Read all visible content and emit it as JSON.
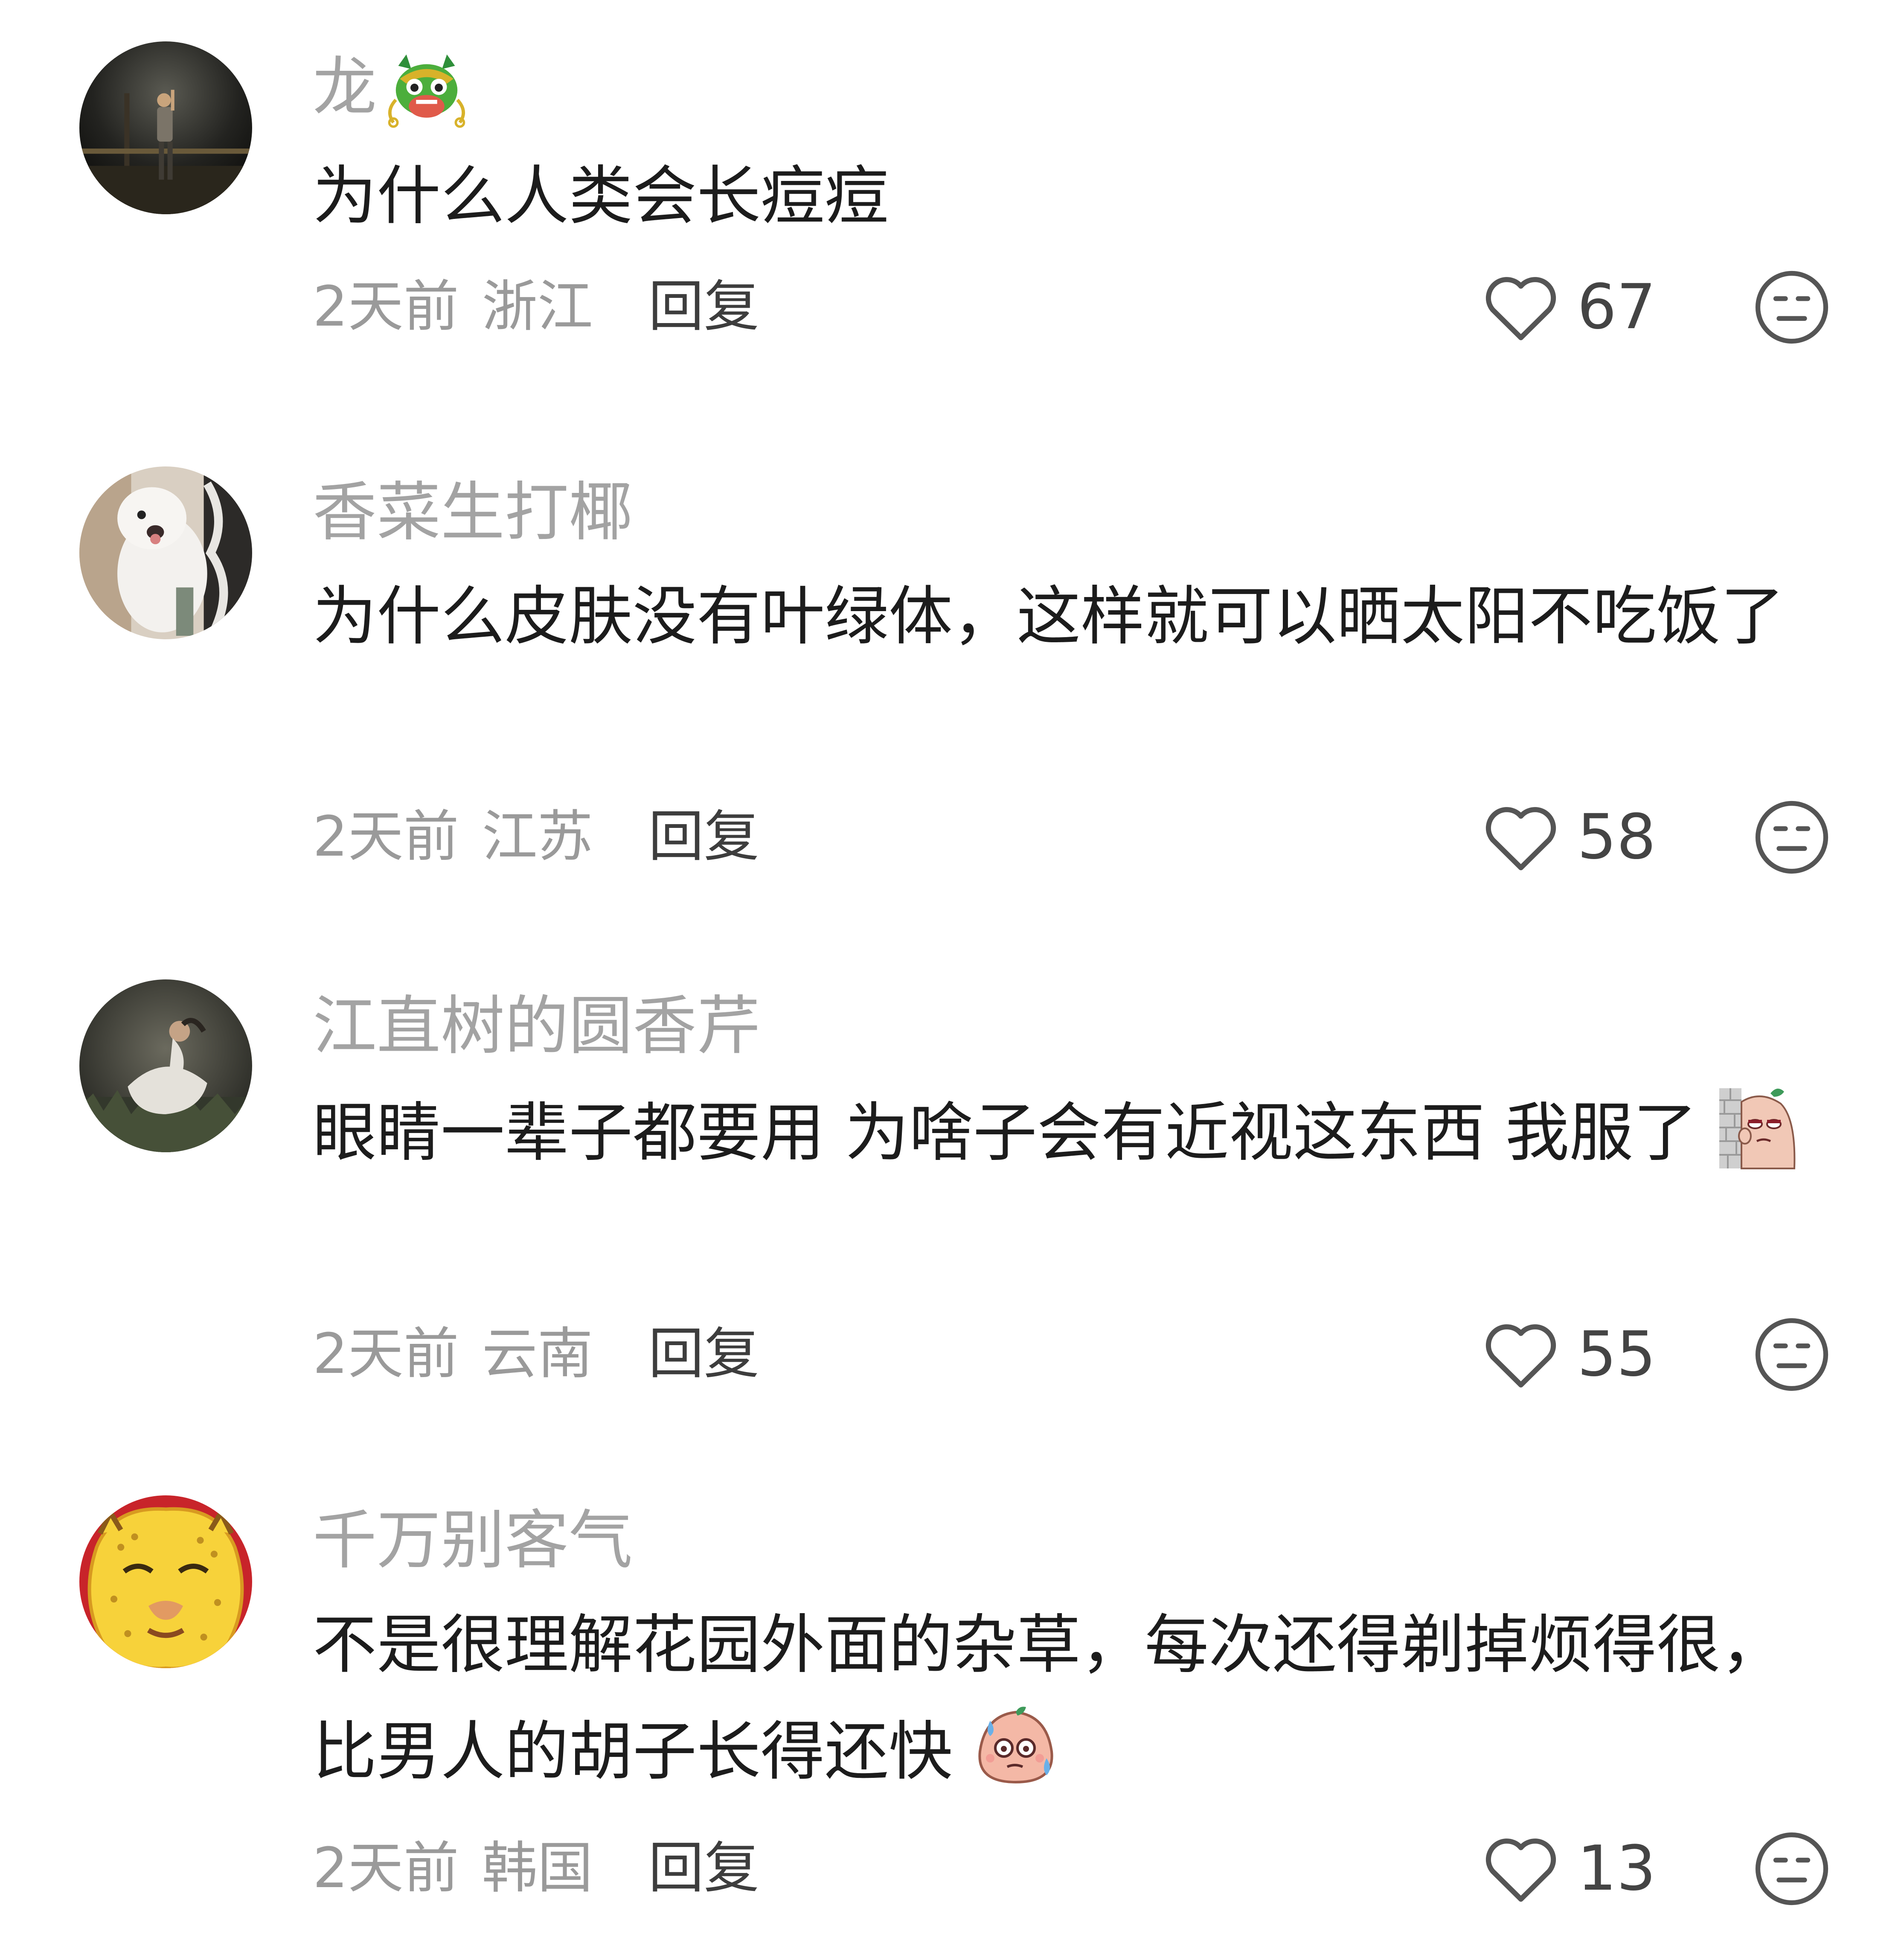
{
  "comments": [
    {
      "username": "龙",
      "username_badge": "dragon-emoji",
      "text": "为什么人类会长痘痘",
      "inline_sticker": "",
      "time": "2天前",
      "location": "浙江",
      "reply_label": "回复",
      "likes": "67",
      "avatar": "night-photo-man-leaning-post"
    },
    {
      "username": "香菜生打椰",
      "username_badge": "",
      "text": "为什么皮肤没有叶绿体，这样就可以晒太阳不吃饭了",
      "inline_sticker": "",
      "time": "2天前",
      "location": "江苏",
      "reply_label": "回复",
      "likes": "58",
      "avatar": "white-fluffy-dog"
    },
    {
      "username": "江直树的圆香芹",
      "username_badge": "",
      "text": "眼睛一辈子都要用 为啥子会有近视这东西 我服了",
      "inline_sticker": "peeking-wall-sticker",
      "time": "2天前",
      "location": "云南",
      "reply_label": "回复",
      "likes": "55",
      "avatar": "girl-white-dress-grass"
    },
    {
      "username": "千万别客气",
      "username_badge": "",
      "text": "不是很理解花园外面的杂草，每次还得剃掉烦得很，比男人的胡子长得还快",
      "inline_sticker": "sweating-blob-sticker",
      "time": "2天前",
      "location": "韩国",
      "reply_label": "回复",
      "likes": "13",
      "avatar": "cartoon-leopard-face"
    }
  ],
  "colors": {
    "username": "#a3a3a3",
    "text": "#1c1c1c",
    "meta": "#9a9a9a",
    "reply": "#3d3d3d",
    "icon": "#555555"
  },
  "icons": {
    "like": "heart-outline-icon",
    "dislike": "neutral-face-icon"
  }
}
